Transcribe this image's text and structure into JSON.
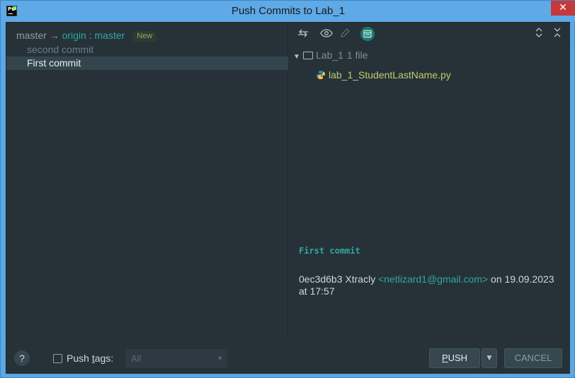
{
  "window": {
    "title": "Push Commits to Lab_1",
    "close_glyph": "✕",
    "logo_text": "PC"
  },
  "left": {
    "branch": {
      "local": "master",
      "arrow": "→",
      "remote": "origin",
      "separator": ":",
      "remote_branch": "master",
      "badge": "New"
    },
    "commits": [
      {
        "label": "second commit",
        "selected": false
      },
      {
        "label": "First commit",
        "selected": true
      }
    ]
  },
  "toolbar": {
    "icons": [
      "compare-arrows-icon",
      "eye-icon",
      "edit-pencil-icon",
      "commit-details-icon",
      "expand-all-icon",
      "collapse-all-icon"
    ]
  },
  "tree": {
    "root_label": "Lab_1",
    "root_count": "1 file",
    "file": "lab_1_StudentLastName.py"
  },
  "details": {
    "subject": "First commit",
    "hash": "0ec3d6b3",
    "author": "Xtracly",
    "email": "<netlizard1@gmail.com>",
    "date_line": "on 19.09.2023",
    "time_line": "at 17:57"
  },
  "bottom": {
    "help": "?",
    "push_tags_label_prefix": "Push ",
    "push_tags_label_u": "t",
    "push_tags_label_suffix": "ags:",
    "tags_value": "All",
    "push_label_u": "P",
    "push_label_rest": "USH",
    "cancel_label": "CANCEL"
  },
  "colors": {
    "accent": "#32a5a0",
    "background": "#263238",
    "selection": "#34454d",
    "file_name": "#c2cd6a"
  }
}
